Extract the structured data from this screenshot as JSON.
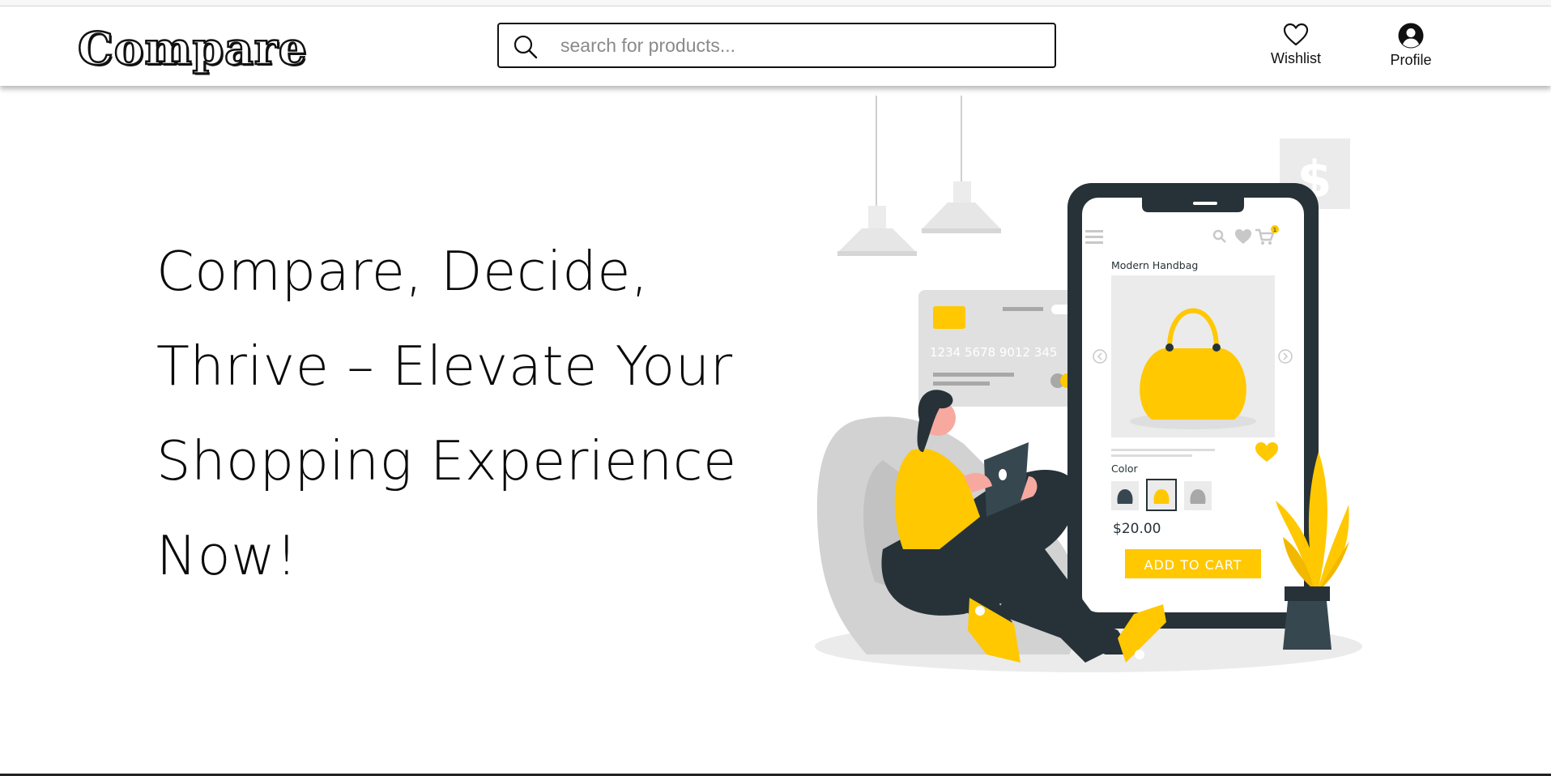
{
  "header": {
    "logo_text": "Compare",
    "search": {
      "placeholder": "search for products...",
      "value": ""
    },
    "wishlist_label": "Wishlist",
    "profile_label": "Profile"
  },
  "hero": {
    "title_lines": [
      "Compare,  Decide,",
      "Thrive –  Elevate Your",
      "Shopping  Experience",
      "Now!"
    ]
  },
  "illustration": {
    "product_name": "Modern Handbag",
    "color_label": "Color",
    "price": "$20.00",
    "cta_label": "ADD TO CART",
    "card_number": "1234  5678  9012  345",
    "dollar_sign": "$",
    "cart_badge": "1"
  },
  "colors": {
    "accent": "#ffc800",
    "dark": "#263238",
    "teal": "#37474f",
    "light_gray": "#ebebeb",
    "mid_gray": "#c7c7c7"
  }
}
